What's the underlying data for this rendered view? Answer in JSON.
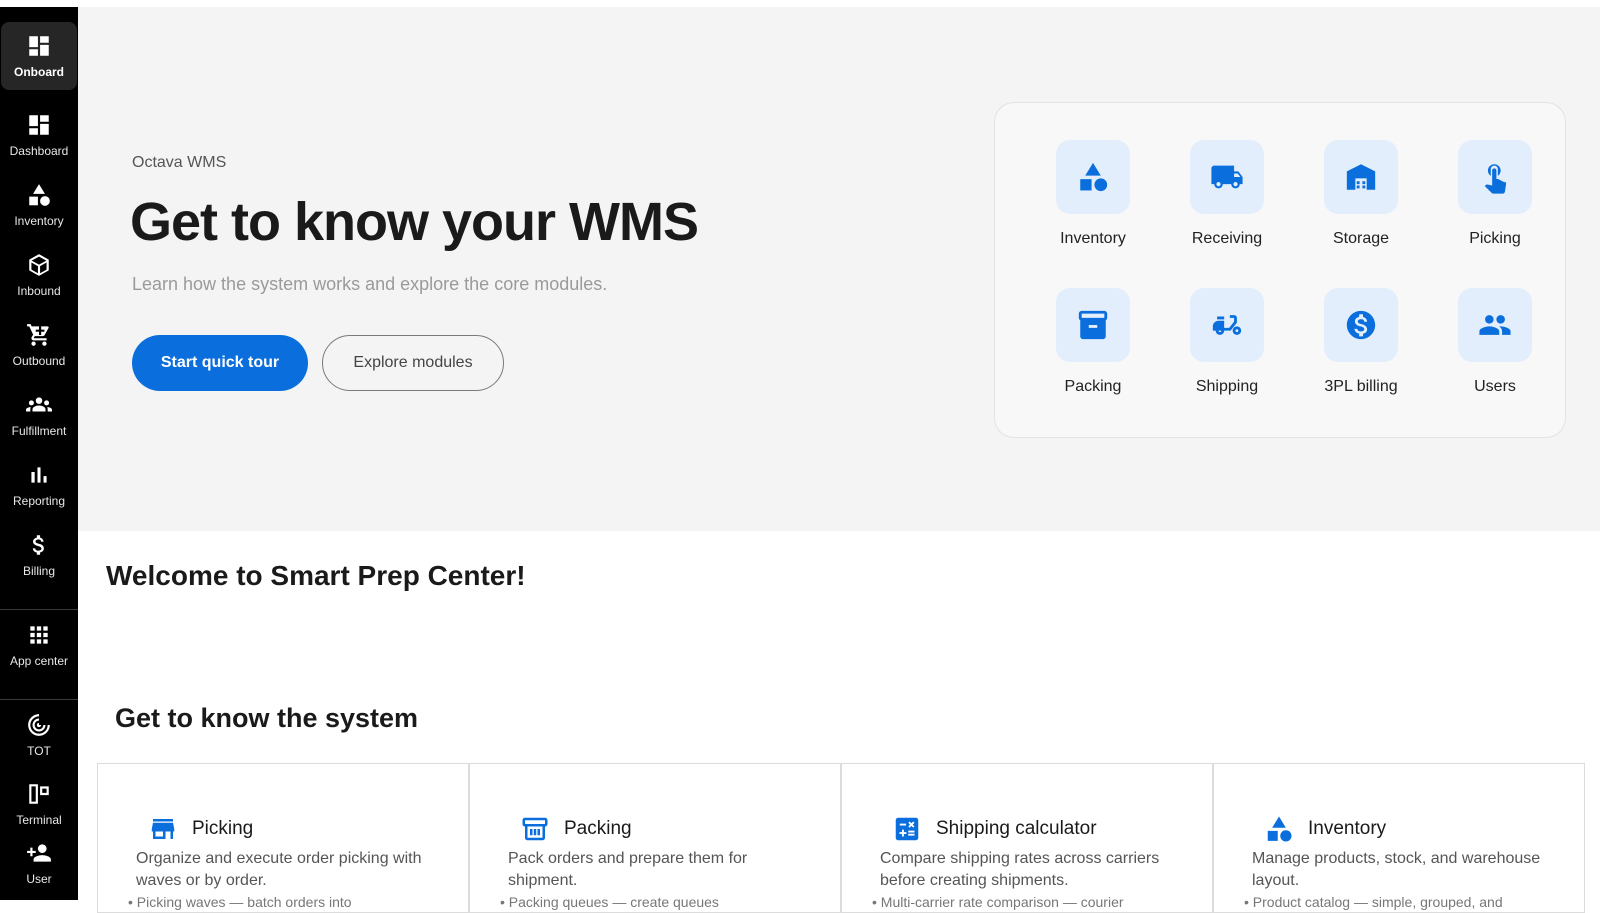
{
  "sidebar": {
    "items": [
      {
        "label": "Onboard",
        "icon": "dashboard-icon",
        "active": true
      },
      {
        "label": "Dashboard",
        "icon": "dashboard-icon"
      },
      {
        "label": "Inventory",
        "icon": "shapes-icon"
      },
      {
        "label": "Inbound",
        "icon": "box-icon"
      },
      {
        "label": "Outbound",
        "icon": "cart-icon"
      },
      {
        "label": "Fulfillment",
        "icon": "people-icon"
      },
      {
        "label": "Reporting",
        "icon": "bar-chart-icon"
      },
      {
        "label": "Billing",
        "icon": "dollar-icon"
      },
      {
        "label": "App center",
        "icon": "apps-grid-icon"
      },
      {
        "label": "TOT",
        "icon": "radar-icon"
      },
      {
        "label": "Terminal",
        "icon": "terminal-device-icon"
      },
      {
        "label": "User",
        "icon": "add-user-icon"
      }
    ]
  },
  "hero": {
    "eyebrow": "Octava WMS",
    "title": "Get to know your WMS",
    "subtitle": "Learn how the system works and explore the core modules.",
    "primary_button": "Start quick tour",
    "secondary_button": "Explore modules"
  },
  "modules": [
    {
      "label": "Inventory",
      "icon": "shapes-icon"
    },
    {
      "label": "Receiving",
      "icon": "truck-icon"
    },
    {
      "label": "Storage",
      "icon": "warehouse-icon"
    },
    {
      "label": "Picking",
      "icon": "hand-pointer-icon"
    },
    {
      "label": "Packing",
      "icon": "archive-box-icon"
    },
    {
      "label": "Shipping",
      "icon": "scooter-icon"
    },
    {
      "label": "3PL billing",
      "icon": "dollar-circle-icon"
    },
    {
      "label": "Users",
      "icon": "people-icon"
    }
  ],
  "welcome": "Welcome to Smart Prep Center!",
  "section_title": "Get to know the system",
  "feature_cards": [
    {
      "title": "Picking",
      "icon": "store-icon",
      "description": "Organize and execute order picking with waves or by order.",
      "bullet": "Picking waves — batch orders into"
    },
    {
      "title": "Packing",
      "icon": "basket-icon",
      "description": "Pack orders and prepare them for shipment.",
      "bullet": "Packing queues — create queues"
    },
    {
      "title": "Shipping calculator",
      "icon": "calculator-icon",
      "description": "Compare shipping rates across carriers before creating shipments.",
      "bullet": "Multi-carrier rate comparison — courier"
    },
    {
      "title": "Inventory",
      "icon": "shapes-icon",
      "description": "Manage products, stock, and warehouse layout.",
      "bullet": "Product catalog — simple, grouped, and"
    }
  ],
  "colors": {
    "accent": "#0a6fdc",
    "tile_bg": "#e3eefc",
    "sidebar_bg": "#000000",
    "hero_bg": "#f4f4f4"
  }
}
